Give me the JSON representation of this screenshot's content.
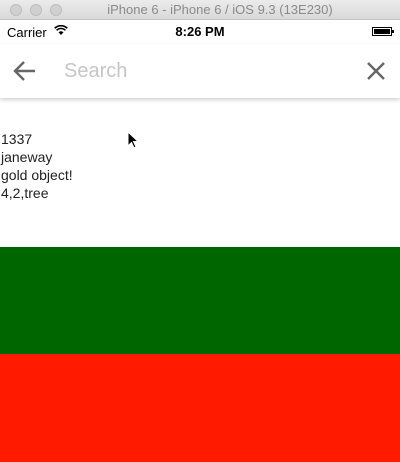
{
  "window": {
    "title": "iPhone 6 - iPhone 6 / iOS 9.3 (13E230)"
  },
  "status_bar": {
    "carrier": "Carrier",
    "time": "8:26 PM",
    "wifi_icon": "wifi-icon",
    "battery_icon": "battery-icon"
  },
  "search": {
    "placeholder": "Search",
    "value": "",
    "back_icon": "back-arrow-icon",
    "close_icon": "close-icon"
  },
  "results": {
    "lines": [
      "1337",
      "janeway",
      "gold object!",
      "4,2,tree"
    ]
  },
  "colors": {
    "green_band": "#006700",
    "red_band": "#ff1a00"
  }
}
